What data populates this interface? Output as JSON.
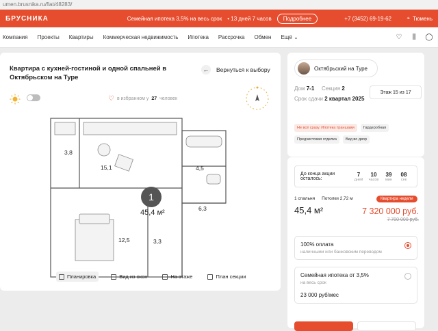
{
  "browser": {
    "url": "umen.brusnika.ru/flat/48283/"
  },
  "topbar": {
    "logo": "БРУСНИКА",
    "promo_text": "Семейная ипотека 3,5% на весь срок",
    "promo_timer": "• 13 дней 7 часов",
    "more_label": "Подробнее",
    "phone": "+7 (3452) 69-19-62",
    "city": "Тюмень",
    "color": "#e54d2e"
  },
  "nav": {
    "items": [
      "Компания",
      "Проекты",
      "Квартиры",
      "Коммерческая недвижимость",
      "Ипотека",
      "Рассрочка",
      "Обмен",
      "Ещё"
    ]
  },
  "flat": {
    "title": "Квартира с кухней-гостиной и одной спальней в Октябрьском на Туре",
    "back_label": "Вернуться к выбору",
    "favorites": "в избранном у",
    "favorites_count": "27",
    "favorites_suffix": "человек",
    "plan": {
      "number": "1",
      "total_area": "45,4",
      "unit": "м²",
      "rooms": [
        "3,8",
        "15,1",
        "4,5",
        "6,3",
        "12,5",
        "3,3"
      ]
    },
    "views": [
      "Планировка",
      "Вид из окон",
      "На этаже",
      "План секции"
    ]
  },
  "project": {
    "name": "Октябрьский на Туре",
    "house_label": "Дом",
    "house_value": "7-1",
    "section_label": "Секция",
    "section_value": "2",
    "delivery_label": "Срок сдачи",
    "delivery_value": "2 квартал 2025",
    "floor": "Этаж 15 из 17",
    "tags": [
      "Не всё сразу. Ипотека траншами",
      "Гардеробная",
      "Предчистовая отделка",
      "Вид во двор"
    ]
  },
  "offer": {
    "timer_label": "До конца акции осталось:",
    "timer": [
      {
        "n": "7",
        "u": "дней"
      },
      {
        "n": "10",
        "u": "часов"
      },
      {
        "n": "39",
        "u": "мин"
      },
      {
        "n": "08",
        "u": "сек"
      }
    ],
    "bedrooms": "1 спальня",
    "ceiling": "Потолки 2,72 м",
    "badge": "Квартира недели",
    "area": "45,4 м²",
    "price": "7 320 000 руб.",
    "old_price": "7 700 000 руб.",
    "options": [
      {
        "title": "100% оплата",
        "subtitle": "наличными или банковским переводом",
        "price": ""
      },
      {
        "title": "Семейная ипотека от 3,5%",
        "subtitle": "на весь срок",
        "price": "23 000 руб/мес"
      }
    ]
  }
}
